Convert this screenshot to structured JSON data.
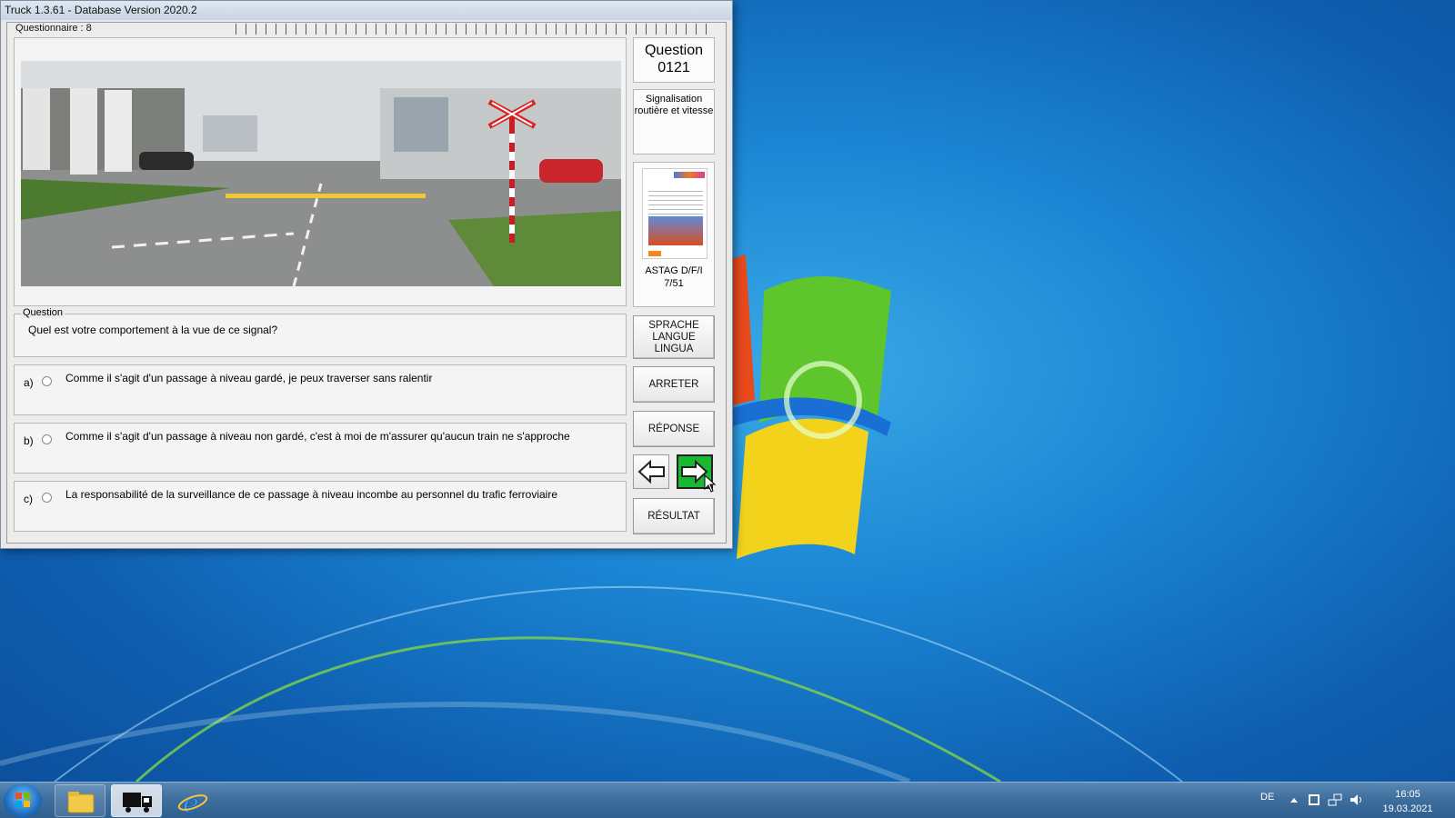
{
  "window": {
    "title": "Truck 1.3.61 - Database Version 2020.2",
    "questionnaire_label": "Questionnaire : 8"
  },
  "question_panel": {
    "number_title": "Question",
    "number": "0121",
    "category": "Signalisation routière et vitesse",
    "book_label": "ASTAG D/F/I",
    "book_page": "7/51"
  },
  "question": {
    "legend": "Question",
    "text": "Quel est votre comportement à la vue de ce signal?"
  },
  "answers": [
    {
      "letter": "a)",
      "text": "Comme il s'agit d'un passage à niveau gardé, je peux traverser sans ralentir"
    },
    {
      "letter": "b)",
      "text": "Comme il s'agit d'un passage à niveau non gardé, c'est à moi de m'assurer qu'aucun train ne s'approche"
    },
    {
      "letter": "c)",
      "text": "La responsabilité de la surveillance de ce passage à niveau incombe au personnel du trafic ferroviaire"
    }
  ],
  "buttons": {
    "language_line1": "SPRACHE",
    "language_line2": "LANGUE",
    "language_line3": "LINGUA",
    "stop": "ARRETER",
    "answer": "RÉPONSE",
    "result": "RÉSULTAT"
  },
  "taskbar": {
    "language": "DE",
    "time": "16:05",
    "date": "19.03.2021"
  },
  "icons": [
    "start-orb-icon",
    "file-explorer-icon",
    "truck-app-icon",
    "internet-explorer-icon",
    "arrow-left-icon",
    "arrow-right-icon",
    "network-icon",
    "volume-icon",
    "action-center-icon",
    "show-hidden-icons-icon"
  ],
  "colors": {
    "next_button": "#18b832",
    "desktop": "#1b86d4",
    "taskbar": "#3f6f9f"
  }
}
